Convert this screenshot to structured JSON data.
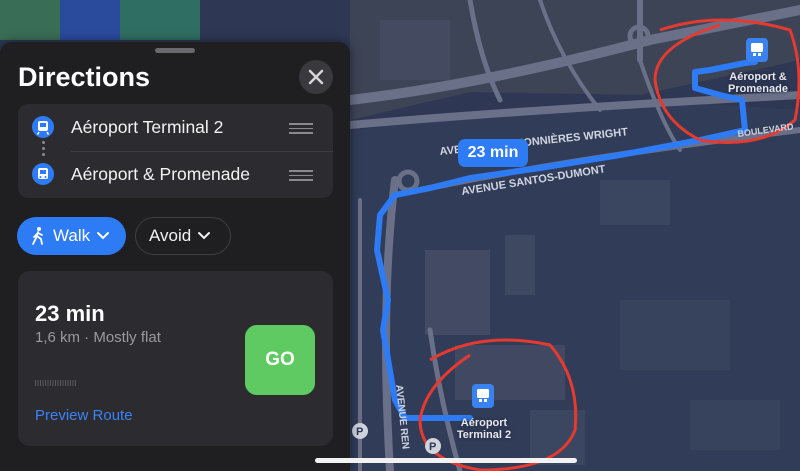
{
  "panel": {
    "title": "Directions",
    "stops": [
      {
        "label": "Aéroport Terminal 2",
        "icon": "transit-icon"
      },
      {
        "label": "Aéroport & Promenade",
        "icon": "bus-icon"
      }
    ],
    "mode_chip": "Walk",
    "avoid_chip": "Avoid"
  },
  "route": {
    "time": "23 min",
    "details": "1,6 km · Mostly flat",
    "go_label": "GO",
    "preview_label": "Preview Route"
  },
  "map": {
    "eta_bubble": "23 min",
    "streets": {
      "wright": "AVENUE DES PIONNIÈRES WRIGHT",
      "santos": "AVENUE SANTOS-DUMONT",
      "boulevard": "BOULEVARD",
      "ren": "AVENUE REN"
    },
    "destination_label_line1": "Aéroport &",
    "destination_label_line2": "Promenade",
    "origin_label_line1": "Aéroport",
    "origin_label_line2": "Terminal 2",
    "parking_symbol": "P"
  },
  "colors": {
    "accent": "#2d7cf6",
    "go": "#5fca62",
    "annotation": "#e53a2f",
    "panel_bg": "#1f1f22"
  }
}
